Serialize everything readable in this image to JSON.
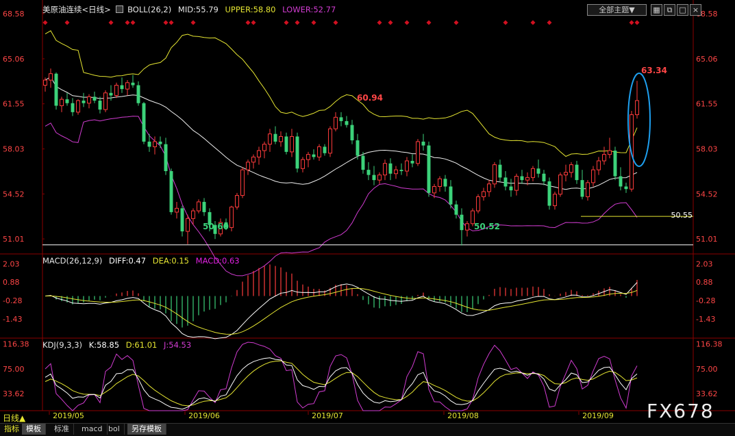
{
  "main_header": {
    "title": "美原油连续<日线>",
    "indicator": "BOLL(26,2)",
    "mid": "MID:55.79",
    "upper": "UPPER:58.80",
    "lower": "LOWER:52.77"
  },
  "top_right": {
    "theme_button": "全部主题▼",
    "icons": [
      "grid-icon",
      "restore-icon",
      "maximize-icon",
      "close-icon"
    ]
  },
  "macd_header": {
    "indicator": "MACD(26,12,9)",
    "diff": "DIFF:0.47",
    "dea": "DEA:0.15",
    "macd": "MACD:0.63"
  },
  "kdj_header": {
    "indicator": "KDJ(9,3,3)",
    "k": "K:58.85",
    "d": "D:61.01",
    "j": "J:54.53"
  },
  "bottom_tabs": [
    "模板",
    "标准",
    "macd",
    "bol",
    "另存模板"
  ],
  "bottom_left": {
    "label": "指标",
    "daily": "日线▲"
  },
  "watermark": "FX678",
  "chart_data": [
    {
      "type": "candlestick",
      "title": "美原油连续<日线>",
      "y_ticks": [
        "68.58",
        "65.06",
        "61.55",
        "58.03",
        "54.52",
        "51.01"
      ],
      "ylim": [
        50.0,
        68.9
      ],
      "x_ticks": [
        "2019/05",
        "2019/06",
        "2019/07",
        "2019/08",
        "2019/09"
      ],
      "annotations": {
        "high_label": "63.34",
        "mid_high_label": "60.94",
        "low_label_1": "50.60",
        "low_label_2": "50.52",
        "support_label": "50.55"
      },
      "support_line": 50.55,
      "short_line": 52.77,
      "candles": [
        [
          63.0,
          63.6,
          62.5,
          63.4
        ],
        [
          63.4,
          64.3,
          62.8,
          63.9
        ],
        [
          63.9,
          64.0,
          61.1,
          61.4
        ],
        [
          61.4,
          62.1,
          60.9,
          61.9
        ],
        [
          61.9,
          62.4,
          61.4,
          61.6
        ],
        [
          61.6,
          62.0,
          60.6,
          60.9
        ],
        [
          60.9,
          61.9,
          60.7,
          61.8
        ],
        [
          61.8,
          62.4,
          61.3,
          61.6
        ],
        [
          61.6,
          62.3,
          61.2,
          62.1
        ],
        [
          62.1,
          62.5,
          61.6,
          61.8
        ],
        [
          61.8,
          62.1,
          60.8,
          61.1
        ],
        [
          61.1,
          62.6,
          60.9,
          62.4
        ],
        [
          62.4,
          63.0,
          61.8,
          62.2
        ],
        [
          62.2,
          63.2,
          62.0,
          63.0
        ],
        [
          63.0,
          63.6,
          62.4,
          62.7
        ],
        [
          62.7,
          63.4,
          62.2,
          63.2
        ],
        [
          63.2,
          63.8,
          62.8,
          63.0
        ],
        [
          63.0,
          63.3,
          61.4,
          61.6
        ],
        [
          61.6,
          61.7,
          58.4,
          58.6
        ],
        [
          58.6,
          59.2,
          57.8,
          58.2
        ],
        [
          58.2,
          59.0,
          57.6,
          58.6
        ],
        [
          58.6,
          59.0,
          58.1,
          58.4
        ],
        [
          58.4,
          58.9,
          56.0,
          56.3
        ],
        [
          56.3,
          56.5,
          52.9,
          53.1
        ],
        [
          53.1,
          53.9,
          52.6,
          53.4
        ],
        [
          53.4,
          53.6,
          51.2,
          51.6
        ],
        [
          51.6,
          52.9,
          50.6,
          52.6
        ],
        [
          52.6,
          53.4,
          52.1,
          53.2
        ],
        [
          53.2,
          54.1,
          53.0,
          53.9
        ],
        [
          53.9,
          54.2,
          52.8,
          53.1
        ],
        [
          53.1,
          53.4,
          51.6,
          52.1
        ],
        [
          52.1,
          52.4,
          51.0,
          51.4
        ],
        [
          51.4,
          52.6,
          51.2,
          52.3
        ],
        [
          52.3,
          52.6,
          51.7,
          51.9
        ],
        [
          51.9,
          53.6,
          51.6,
          53.5
        ],
        [
          53.5,
          54.6,
          53.3,
          54.4
        ],
        [
          54.4,
          56.6,
          54.2,
          56.4
        ],
        [
          56.4,
          57.2,
          56.0,
          57.0
        ],
        [
          57.0,
          57.6,
          56.5,
          57.4
        ],
        [
          57.4,
          58.2,
          56.8,
          57.9
        ],
        [
          57.9,
          58.6,
          57.3,
          58.4
        ],
        [
          58.4,
          59.6,
          57.8,
          59.2
        ],
        [
          59.2,
          59.8,
          58.4,
          58.6
        ],
        [
          58.6,
          59.4,
          58.2,
          59.0
        ],
        [
          59.0,
          59.3,
          57.6,
          57.8
        ],
        [
          57.8,
          59.6,
          57.4,
          59.0
        ],
        [
          59.0,
          59.3,
          56.2,
          56.5
        ],
        [
          56.5,
          57.4,
          56.2,
          57.2
        ],
        [
          57.2,
          57.8,
          56.6,
          57.6
        ],
        [
          57.6,
          58.0,
          57.2,
          57.4
        ],
        [
          57.4,
          58.4,
          57.1,
          58.2
        ],
        [
          58.2,
          58.4,
          57.5,
          57.7
        ],
        [
          57.7,
          59.8,
          57.4,
          59.6
        ],
        [
          59.6,
          60.9,
          59.4,
          60.5
        ],
        [
          60.5,
          60.9,
          59.8,
          60.2
        ],
        [
          60.2,
          60.6,
          59.7,
          59.9
        ],
        [
          59.9,
          60.3,
          58.4,
          58.7
        ],
        [
          58.7,
          59.2,
          57.2,
          57.5
        ],
        [
          57.5,
          57.8,
          56.1,
          56.4
        ],
        [
          56.4,
          57.0,
          55.6,
          56.0
        ],
        [
          56.0,
          56.7,
          55.2,
          55.6
        ],
        [
          55.6,
          56.2,
          55.3,
          56.0
        ],
        [
          56.0,
          57.2,
          55.6,
          56.9
        ],
        [
          56.9,
          57.3,
          55.6,
          56.1
        ],
        [
          56.1,
          56.7,
          55.7,
          56.4
        ],
        [
          56.4,
          56.9,
          56.0,
          56.3
        ],
        [
          56.3,
          57.4,
          55.9,
          57.1
        ],
        [
          57.1,
          57.6,
          56.6,
          56.9
        ],
        [
          56.9,
          58.8,
          56.7,
          58.6
        ],
        [
          58.6,
          59.2,
          57.9,
          58.3
        ],
        [
          58.3,
          58.6,
          54.3,
          54.6
        ],
        [
          54.6,
          55.3,
          54.2,
          55.1
        ],
        [
          55.1,
          55.9,
          54.7,
          55.7
        ],
        [
          55.7,
          56.0,
          54.7,
          55.1
        ],
        [
          55.1,
          55.6,
          53.4,
          53.7
        ],
        [
          53.7,
          54.0,
          52.6,
          52.9
        ],
        [
          52.9,
          53.4,
          50.5,
          51.7
        ],
        [
          51.7,
          52.4,
          51.2,
          52.2
        ],
        [
          52.2,
          53.4,
          52.0,
          53.2
        ],
        [
          53.2,
          54.5,
          53.0,
          54.3
        ],
        [
          54.3,
          55.0,
          54.0,
          54.7
        ],
        [
          54.7,
          55.6,
          54.3,
          55.3
        ],
        [
          55.3,
          57.0,
          55.0,
          56.8
        ],
        [
          56.8,
          57.2,
          55.5,
          55.8
        ],
        [
          55.8,
          56.3,
          54.8,
          55.1
        ],
        [
          55.1,
          55.7,
          54.3,
          54.8
        ],
        [
          54.8,
          56.1,
          54.4,
          55.9
        ],
        [
          55.9,
          56.4,
          55.3,
          55.6
        ],
        [
          55.6,
          56.2,
          55.2,
          55.8
        ],
        [
          55.8,
          56.7,
          55.5,
          56.5
        ],
        [
          56.5,
          57.2,
          55.8,
          56.1
        ],
        [
          56.1,
          56.4,
          55.2,
          55.5
        ],
        [
          55.5,
          55.8,
          53.3,
          53.6
        ],
        [
          53.6,
          54.7,
          53.3,
          54.5
        ],
        [
          54.5,
          56.2,
          54.3,
          56.0
        ],
        [
          56.0,
          56.8,
          55.5,
          56.2
        ],
        [
          56.2,
          57.0,
          55.8,
          56.8
        ],
        [
          56.8,
          57.1,
          55.3,
          55.6
        ],
        [
          55.6,
          56.4,
          54.1,
          54.3
        ],
        [
          54.3,
          55.6,
          54.0,
          55.4
        ],
        [
          55.4,
          56.7,
          55.1,
          56.4
        ],
        [
          56.4,
          57.4,
          56.0,
          57.1
        ],
        [
          57.1,
          58.2,
          56.8,
          57.6
        ],
        [
          57.6,
          58.9,
          57.3,
          57.9
        ],
        [
          57.9,
          58.2,
          55.6,
          55.9
        ],
        [
          55.9,
          56.6,
          54.8,
          55.1
        ],
        [
          55.1,
          55.4,
          54.6,
          54.9
        ],
        [
          54.9,
          61.0,
          54.7,
          60.7
        ],
        [
          60.7,
          63.34,
          60.4,
          61.8
        ]
      ]
    },
    {
      "type": "bar+line",
      "title": "MACD(26,12,9)",
      "y_ticks": [
        "2.03",
        "0.88",
        "-0.28",
        "-1.43"
      ],
      "ylim": [
        -2.6,
        2.6
      ]
    },
    {
      "type": "line",
      "title": "KDJ(9,3,3)",
      "y_ticks": [
        "116.38",
        "75.00",
        "33.62"
      ],
      "ylim": [
        5,
        125
      ]
    }
  ],
  "colors": {
    "up": "#ff3c3c",
    "down": "#3cd27a",
    "mid": "#f0f0f0",
    "upper": "#e6e632",
    "lower": "#d23cd2",
    "axis_text": "#ff4646",
    "ellipse": "#1ea0f0",
    "diff": "#ffffff",
    "dea": "#e6e632",
    "macd_label": "#e020e0",
    "k": "#ffffff",
    "d": "#e6e632",
    "j": "#d23cd2"
  }
}
